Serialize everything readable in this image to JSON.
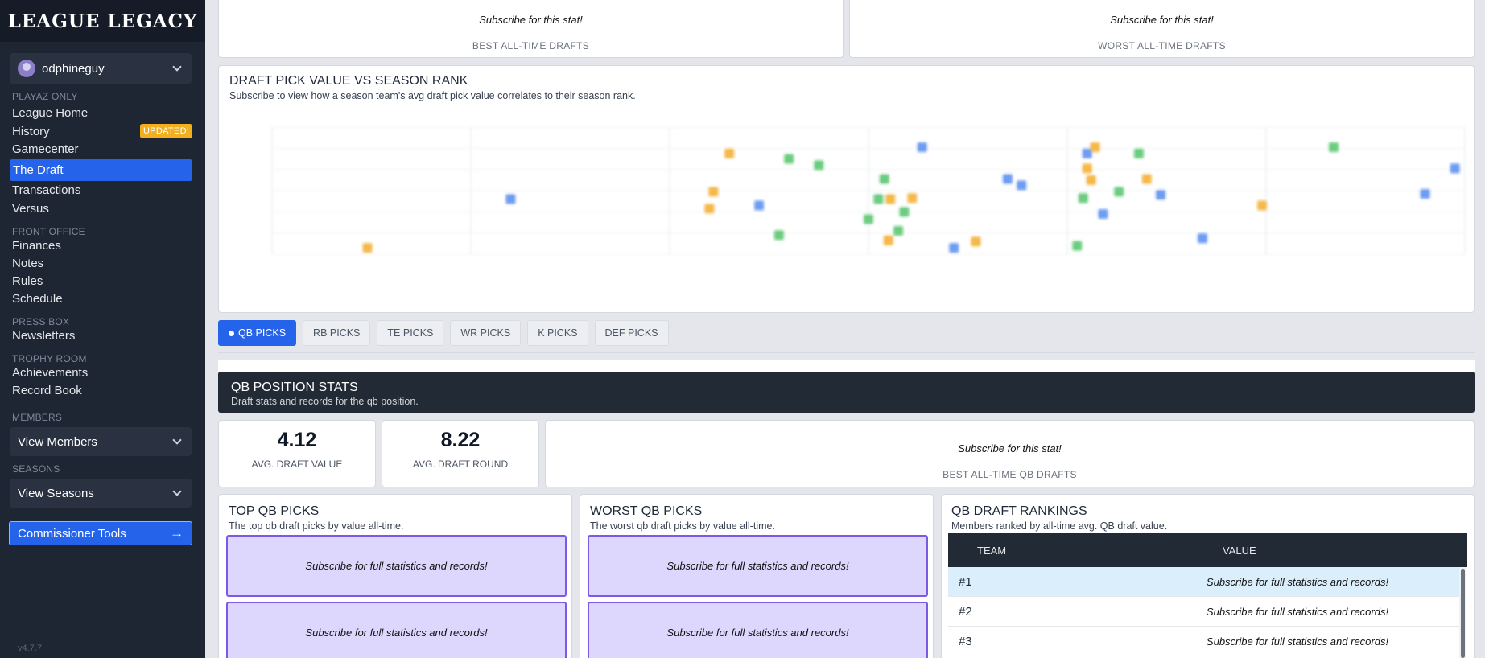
{
  "app": {
    "logo": "LEAGUE LEGACY",
    "version": "v4.7.7"
  },
  "user": {
    "name": "odphineguy"
  },
  "sidebar": {
    "sections": [
      {
        "label": "PLAYAZ ONLY"
      },
      {
        "label": "FRONT OFFICE"
      },
      {
        "label": "PRESS BOX"
      },
      {
        "label": "TROPHY ROOM"
      },
      {
        "label": "MEMBERS"
      },
      {
        "label": "SEASONS"
      }
    ],
    "items": [
      {
        "label": "League Home"
      },
      {
        "label": "History",
        "badge": "UPDATED!"
      },
      {
        "label": "Gamecenter"
      },
      {
        "label": "The Draft"
      },
      {
        "label": "Transactions"
      },
      {
        "label": "Versus"
      },
      {
        "label": "Finances"
      },
      {
        "label": "Notes"
      },
      {
        "label": "Rules"
      },
      {
        "label": "Schedule"
      },
      {
        "label": "Newsletters"
      },
      {
        "label": "Achievements"
      },
      {
        "label": "Record Book"
      }
    ],
    "members_dropdown": "View Members",
    "seasons_dropdown": "View Seasons",
    "commissioner": "Commissioner Tools"
  },
  "top_cards": [
    {
      "message": "Subscribe for this stat!",
      "label": "BEST ALL-TIME DRAFTS"
    },
    {
      "message": "Subscribe for this stat!",
      "label": "WORST ALL-TIME DRAFTS"
    }
  ],
  "chart_section": {
    "title": "DRAFT PICK VALUE VS SEASON RANK",
    "subtitle": "Subscribe to view how a season team's avg draft pick value correlates to their season rank."
  },
  "chart_data": {
    "type": "scatter",
    "title": "",
    "xlabel": "",
    "ylabel": "",
    "xlim": [
      0,
      6
    ],
    "ylim": [
      0,
      6
    ],
    "grid": true,
    "series": [
      {
        "color": "#6d9cf2",
        "points": [
          [
            1.2,
            2.6
          ],
          [
            2.45,
            2.3
          ],
          [
            3.27,
            5.05
          ],
          [
            3.43,
            0.3
          ],
          [
            3.7,
            3.55
          ],
          [
            3.77,
            3.25
          ],
          [
            4.1,
            4.75
          ],
          [
            4.18,
            1.9
          ],
          [
            4.47,
            2.8
          ],
          [
            4.68,
            0.75
          ],
          [
            5.8,
            2.85
          ],
          [
            5.95,
            4.05
          ]
        ]
      },
      {
        "color": "#f5b84a",
        "points": [
          [
            0.48,
            0.3
          ],
          [
            2.2,
            2.15
          ],
          [
            2.3,
            4.75
          ],
          [
            2.22,
            2.95
          ],
          [
            3.1,
            0.65
          ],
          [
            3.11,
            2.6
          ],
          [
            3.22,
            2.65
          ],
          [
            3.54,
            0.6
          ],
          [
            4.1,
            4.05
          ],
          [
            4.14,
            5.05
          ],
          [
            4.12,
            3.5
          ],
          [
            4.4,
            3.55
          ],
          [
            4.98,
            2.3
          ]
        ]
      },
      {
        "color": "#6ccc7f",
        "points": [
          [
            2.55,
            0.9
          ],
          [
            2.6,
            4.5
          ],
          [
            2.75,
            4.2
          ],
          [
            3.0,
            1.65
          ],
          [
            3.05,
            2.6
          ],
          [
            3.08,
            3.55
          ],
          [
            3.18,
            2.0
          ],
          [
            3.15,
            1.1
          ],
          [
            4.05,
            0.4
          ],
          [
            4.08,
            2.65
          ],
          [
            4.26,
            2.95
          ],
          [
            4.36,
            4.75
          ],
          [
            5.34,
            5.05
          ]
        ]
      }
    ]
  },
  "tabs": [
    {
      "label": "QB PICKS",
      "active": true
    },
    {
      "label": "RB PICKS"
    },
    {
      "label": "TE PICKS"
    },
    {
      "label": "WR PICKS"
    },
    {
      "label": "K PICKS"
    },
    {
      "label": "DEF PICKS"
    }
  ],
  "position_stats": {
    "title": "QB POSITION STATS",
    "subtitle": "Draft stats and records for the qb position.",
    "avg_value": "4.12",
    "avg_value_label": "AVG. DRAFT VALUE",
    "avg_round": "8.22",
    "avg_round_label": "AVG. DRAFT ROUND",
    "best_message": "Subscribe for this stat!",
    "best_label": "BEST ALL-TIME QB DRAFTS"
  },
  "top_picks": {
    "title": "TOP QB PICKS",
    "subtitle": "The top qb draft picks by value all-time.",
    "items": [
      "Subscribe for full statistics and records!",
      "Subscribe for full statistics and records!"
    ]
  },
  "worst_picks": {
    "title": "WORST QB PICKS",
    "subtitle": "The worst qb draft picks by value all-time.",
    "items": [
      "Subscribe for full statistics and records!",
      "Subscribe for full statistics and records!"
    ]
  },
  "rankings": {
    "title": "QB DRAFT RANKINGS",
    "subtitle": "Members ranked by all-time avg. QB draft value.",
    "col_team": "TEAM",
    "col_value": "VALUE",
    "rows": [
      {
        "rank": "#1",
        "value": "Subscribe for full statistics and records!"
      },
      {
        "rank": "#2",
        "value": "Subscribe for full statistics and records!"
      },
      {
        "rank": "#3",
        "value": "Subscribe for full statistics and records!"
      }
    ]
  }
}
